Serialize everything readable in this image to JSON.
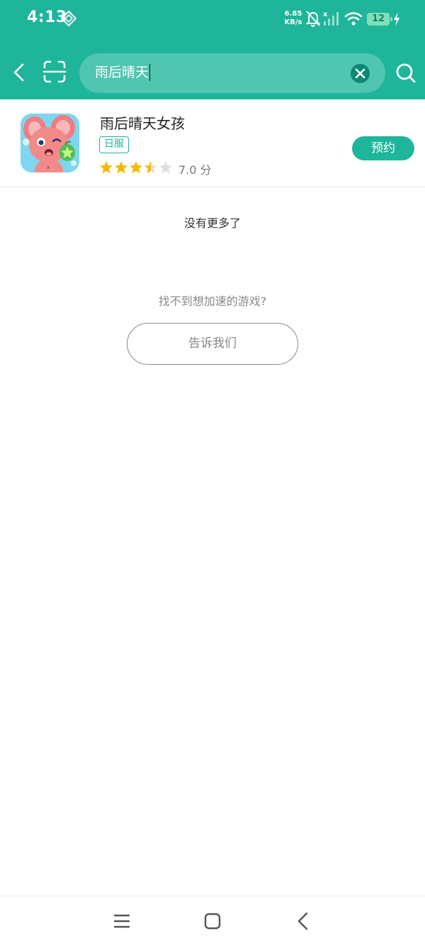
{
  "status_bar": {
    "time": "4:13",
    "net_speed_value": "6.85",
    "net_speed_unit": "KB/s",
    "battery": "12",
    "icons": [
      "location-diamond-icon",
      "bell-off-icon",
      "cellular-signal-icon",
      "wifi-icon",
      "battery-icon",
      "charging-bolt-icon"
    ]
  },
  "search": {
    "query": "雨后晴天",
    "icons": [
      "back-arrow-icon",
      "scan-icon",
      "clear-icon",
      "search-icon"
    ]
  },
  "results": [
    {
      "title": "雨后晴天女孩",
      "tag": "日服",
      "rating_value": 3.5,
      "rating_max": 5,
      "rating_text": "7.0 分",
      "action_label": "预约"
    }
  ],
  "footer": {
    "no_more": "没有更多了",
    "not_found_prompt": "找不到想加速的游戏?",
    "tell_us_label": "告诉我们"
  },
  "nav_bar": {
    "icons": [
      "menu-icon",
      "home-square-icon",
      "back-triangle-icon"
    ]
  },
  "colors": {
    "accent": "#1fb59a",
    "star": "#f5b800",
    "star_empty": "#e0e0e0"
  }
}
